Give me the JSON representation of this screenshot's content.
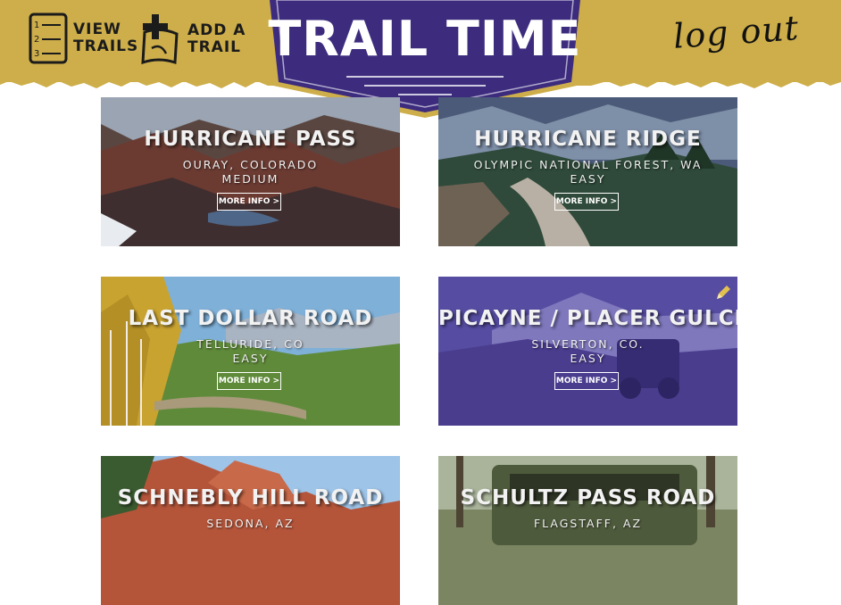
{
  "header": {
    "view_trails": [
      "VIEW",
      "TRAILS"
    ],
    "add_trail": [
      "ADD A",
      "TRAIL"
    ],
    "logo": "TRAIL TIME",
    "logout": "log out"
  },
  "cards": [
    {
      "title": "HURRICANE PASS",
      "location": "OURAY, COLORADO",
      "difficulty": "MEDIUM",
      "more": "MORE INFO >"
    },
    {
      "title": "HURRICANE RIDGE",
      "location": "OLYMPIC NATIONAL FOREST, WA",
      "difficulty": "EASY",
      "more": "MORE INFO >"
    },
    {
      "title": "LAST DOLLAR ROAD",
      "location": "TELLURIDE, CO",
      "difficulty": "EASY",
      "more": "MORE INFO >"
    },
    {
      "title": "PICAYNE / PLACER GULCH",
      "location": "SILVERTON, CO.",
      "difficulty": "EASY",
      "more": "MORE INFO >"
    },
    {
      "title": "SCHNEBLY HILL ROAD",
      "location": "SEDONA, AZ",
      "difficulty": "",
      "more": ""
    },
    {
      "title": "SCHULTZ PASS ROAD",
      "location": "FLAGSTAFF, AZ",
      "difficulty": "",
      "more": ""
    }
  ],
  "colors": {
    "header_gold": "#cdae4a",
    "banner_purple": "#3d2c7e",
    "highlight_overlay": "#4a3a9a"
  },
  "icons": [
    "numbered-list-icon",
    "map-plus-icon",
    "pencil-icon"
  ]
}
